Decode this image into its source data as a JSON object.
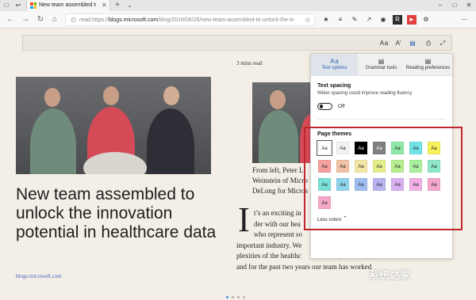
{
  "browser": {
    "tab": {
      "title": "New team assembled to",
      "favicon_colors": [
        "#f25022",
        "#7fba00",
        "#00a4ef",
        "#ffb900"
      ]
    },
    "titlebar_icons": [
      "window-icon",
      "back-tab-icon"
    ],
    "address": {
      "prefix": "read:https://",
      "host": "blogs.microsoft.com",
      "path": "/blog/2018/06/26/new-team-assembled-to-unlock-the-in"
    },
    "extensions": [
      "add-to-favorites-icon",
      "reading-list-icon",
      "pen-icon",
      "share-icon",
      "tracker-icon",
      "ext-1-icon",
      "ext-2-icon",
      "ext-3-icon",
      "more-icon"
    ]
  },
  "reading_toolbar": [
    "text-options-icon",
    "read-aloud-icon",
    "learning-tools-icon",
    "print-icon",
    "fullscreen-icon"
  ],
  "article": {
    "reading_time": "3 mins read",
    "title": "New team assembled to unlock the innovation potential in healthcare data",
    "source": "blogs.microsoft.com",
    "caption_lines": [
      "From left, Peter L",
      "Weinstein of Micro",
      "DeLong for Micros"
    ],
    "dropcap": "I",
    "body_lines": [
      "t’s an exciting in",
      "der with our hea",
      "who represent so",
      "important industry. We",
      "plexities of the healthc",
      "and for the past two years our team has worked"
    ]
  },
  "panel": {
    "tabs": [
      {
        "label": "Text options",
        "icon": "text-options-icon",
        "active": true
      },
      {
        "label": "Grammar tools",
        "icon": "grammar-tools-icon",
        "active": false
      },
      {
        "label": "Reading preferences",
        "icon": "reading-preferences-icon",
        "active": false
      }
    ],
    "spacing_title": "Text spacing",
    "spacing_sub": "Wider spacing could improve reading fluency",
    "toggle_label": "Off",
    "themes_title": "Page themes",
    "theme_label": "Aa",
    "themes": [
      [
        "#ffffff",
        "#f3f3f3",
        "#000000",
        "#7f7f7f",
        "#8ee8a5",
        "#6fe3e6",
        "#f6f25a"
      ],
      [
        "#f6a09e",
        "#f3c2a6",
        "#f4e6a4",
        "#e5ee8a",
        "#b5ee8e",
        "#a9ef9d",
        "#8ee8c8"
      ],
      [
        "#7adfd6",
        "#8ed4ec",
        "#9ebef0",
        "#b8b3ee",
        "#d9b0ef",
        "#f0b0e6",
        "#f3a8cd"
      ],
      [
        "#f4a7c6"
      ]
    ],
    "less_colors": "Less colors"
  },
  "watermark": "系统之家"
}
